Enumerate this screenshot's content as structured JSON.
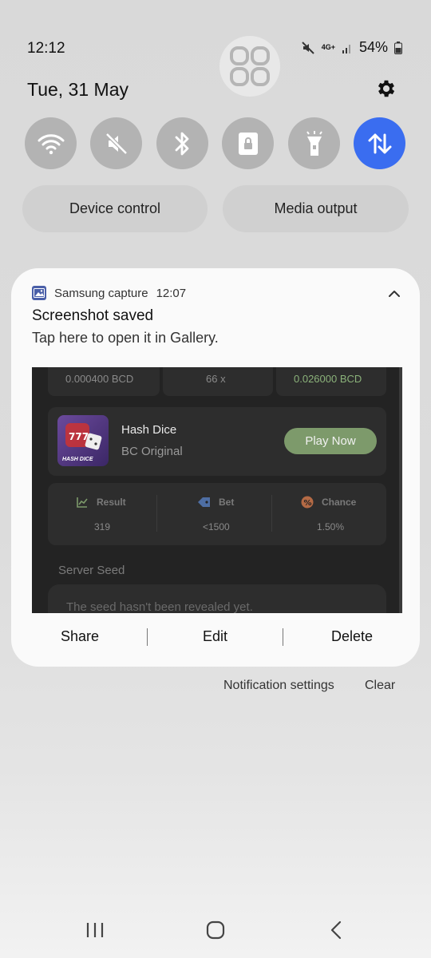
{
  "status": {
    "time": "12:12",
    "network_top": "4G+",
    "battery": "54%"
  },
  "header": {
    "date": "Tue, 31 May"
  },
  "quick_toggles": [
    {
      "name": "wifi-icon",
      "active": false
    },
    {
      "name": "mute-icon",
      "active": false
    },
    {
      "name": "bluetooth-icon",
      "active": false
    },
    {
      "name": "lock-icon",
      "active": false
    },
    {
      "name": "flashlight-icon",
      "active": false
    },
    {
      "name": "data-transfer-icon",
      "active": true
    }
  ],
  "pills": {
    "device_control": "Device control",
    "media_output": "Media output"
  },
  "notification": {
    "app_name": "Samsung capture",
    "time": "12:07",
    "title": "Screenshot saved",
    "body": "Tap here to open it in Gallery.",
    "preview": {
      "top_row": [
        "0.000400 BCD",
        "66 x",
        "0.026000 BCD"
      ],
      "game_title": "Hash Dice",
      "game_subtitle": "BC Original",
      "game_thumb_label": "HASH DICE",
      "play_button": "Play Now",
      "stats": [
        {
          "label": "Result",
          "value": "319"
        },
        {
          "label": "Bet",
          "value": "<1500"
        },
        {
          "label": "Chance",
          "value": "1.50%"
        }
      ],
      "server_seed_label": "Server Seed",
      "seed_text": "The seed hasn't been revealed yet."
    },
    "actions": {
      "share": "Share",
      "edit": "Edit",
      "delete": "Delete"
    }
  },
  "footer": {
    "settings": "Notification settings",
    "clear": "Clear"
  },
  "colors": {
    "accent_blue": "#3a6df0",
    "play_green": "#7d9a6b",
    "value_green": "#8bb27a"
  }
}
